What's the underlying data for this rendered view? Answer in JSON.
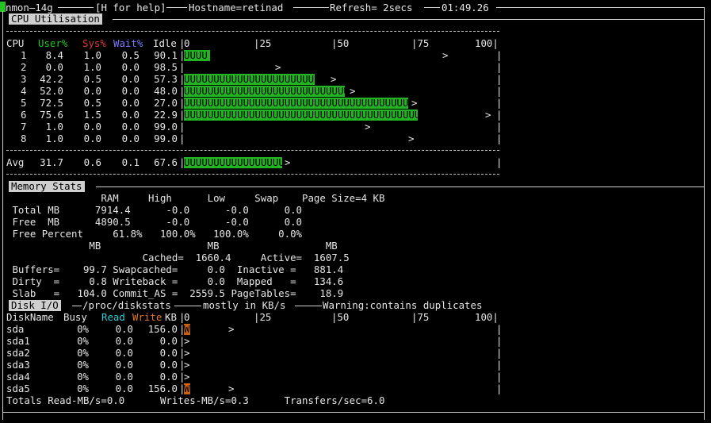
{
  "topbar": {
    "prog": "nmon—14g",
    "help": "[H for help]",
    "host": "Hostname=retinad",
    "refresh": "Refresh= 2secs",
    "time": "01:49.26"
  },
  "cpu": {
    "title": "CPU Utilisation",
    "headers": {
      "cpu": "CPU",
      "user": "User%",
      "sys": "Sys%",
      "wait": "Wait%",
      "idle": "Idle"
    },
    "scale": {
      "s0": "0",
      "s25": "|25",
      "s50": "|50",
      "s75": "|75",
      "s100": "100|"
    },
    "rows": [
      {
        "cpu": "1",
        "user": "8.4",
        "sys": "1.0",
        "wait": "0.5",
        "idle": "90.1",
        "pct": 8.4,
        "peak": 84
      },
      {
        "cpu": "2",
        "user": "0.0",
        "sys": "1.0",
        "wait": "0.0",
        "idle": "98.5",
        "pct": 0,
        "peak": 30
      },
      {
        "cpu": "3",
        "user": "42.2",
        "sys": "0.5",
        "wait": "0.0",
        "idle": "57.3",
        "pct": 42.2,
        "peak": 48
      },
      {
        "cpu": "4",
        "user": "52.0",
        "sys": "0.0",
        "wait": "0.0",
        "idle": "48.0",
        "pct": 52,
        "peak": 54
      },
      {
        "cpu": "5",
        "user": "72.5",
        "sys": "0.5",
        "wait": "0.0",
        "idle": "27.0",
        "pct": 72.5,
        "peak": 74
      },
      {
        "cpu": "6",
        "user": "75.6",
        "sys": "1.5",
        "wait": "0.0",
        "idle": "22.9",
        "pct": 75.6,
        "peak": 98
      },
      {
        "cpu": "7",
        "user": "1.0",
        "sys": "0.0",
        "wait": "0.0",
        "idle": "99.0",
        "pct": 0,
        "peak": 59
      },
      {
        "cpu": "8",
        "user": "1.0",
        "sys": "0.0",
        "wait": "0.0",
        "idle": "99.0",
        "pct": 0,
        "peak": 73
      }
    ],
    "avg": {
      "label": "Avg",
      "user": "31.7",
      "sys": "0.6",
      "wait": "0.1",
      "idle": "67.6",
      "pct": 31.7,
      "peak": 33
    }
  },
  "memory": {
    "title": "Memory Stats",
    "head": "                RAM     High      Low     Swap    Page Size=4 KB",
    "lines": [
      " Total MB      7914.4      -0.0      -0.0      0.0",
      " Free  MB      4890.5      -0.0      -0.0      0.0",
      " Free Percent     61.8%   100.0%   100.0%     0.0%",
      "              MB                  MB                  MB",
      "                       Cached=  1660.4     Active=  1607.5",
      " Buffers=    99.7 Swapcached=     0.0  Inactive =   881.4",
      " Dirty  =     0.8 Writeback =     0.0  Mapped   =   134.6",
      " Slab   =   104.0 Commit_AS =  2559.5 PageTables=    18.9"
    ]
  },
  "disk": {
    "title": "Disk I/O",
    "subtitle": "/proc/diskstats",
    "unit": "mostly in KB/s",
    "warning": "Warning:contains duplicates",
    "headers": {
      "name": "DiskName",
      "busy": "Busy",
      "read": "Read",
      "write": "Write",
      "kb": "KB"
    },
    "scale": {
      "s0": "0",
      "s25": "|25",
      "s50": "|50",
      "s75": "|75",
      "s100": "100|"
    },
    "rows": [
      {
        "name": "sda",
        "busy": "0%",
        "read": "0.0",
        "write": "156.0",
        "w": true
      },
      {
        "name": "sda1",
        "busy": "0%",
        "read": "0.0",
        "write": "0.0",
        "w": false
      },
      {
        "name": "sda2",
        "busy": "0%",
        "read": "0.0",
        "write": "0.0",
        "w": false
      },
      {
        "name": "sda3",
        "busy": "0%",
        "read": "0.0",
        "write": "0.0",
        "w": false
      },
      {
        "name": "sda4",
        "busy": "0%",
        "read": "0.0",
        "write": "0.0",
        "w": false
      },
      {
        "name": "sda5",
        "busy": "0%",
        "read": "0.0",
        "write": "156.0",
        "w": true
      }
    ],
    "totals": "Totals Read-MB/s=0.0      Writes-MB/s=0.3      Transfers/sec=6.0"
  },
  "colors": {
    "bar": "#22b422",
    "user": "#22c322",
    "sys": "#e03a3a",
    "wait": "#7a7aff",
    "read": "#2ec9d6",
    "write": "#e2752a"
  }
}
